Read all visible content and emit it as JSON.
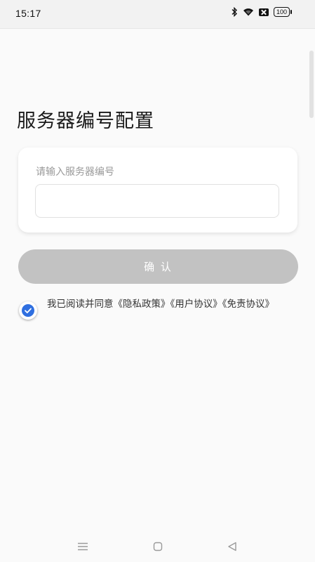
{
  "status_bar": {
    "time": "15:17",
    "battery": "100",
    "icons": [
      "bluetooth-icon",
      "wifi-icon",
      "sim-icon",
      "battery-icon"
    ]
  },
  "page": {
    "title": "服务器编号配置"
  },
  "server_form": {
    "label": "请输入服务器编号",
    "input_value": "",
    "input_placeholder": ""
  },
  "confirm_button": {
    "label": "确 认",
    "enabled": false
  },
  "agreement": {
    "checked": true,
    "text": "我已阅读并同意《隐私政策》《用户协议》《免责协议》"
  },
  "nav_bar": {
    "icons": [
      "menu-icon",
      "home-icon",
      "back-icon"
    ]
  },
  "colors": {
    "accent": "#2f6fe0",
    "button_disabled": "#c2c2c2",
    "label": "#9a9a9a",
    "title": "#1a1a1a"
  }
}
